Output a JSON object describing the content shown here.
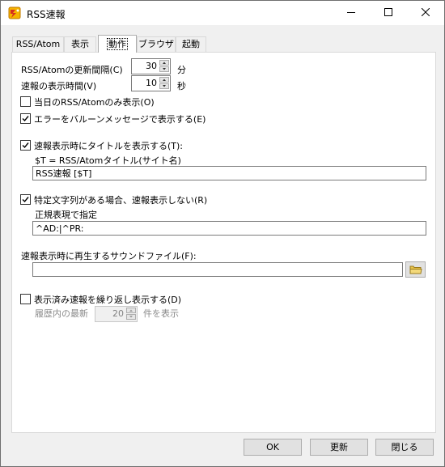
{
  "window": {
    "title": "RSS速報",
    "icon": "rss-app-icon",
    "controls": [
      "minimize-icon",
      "maximize-icon",
      "close-icon"
    ]
  },
  "tabs": [
    {
      "label": "RSS/Atom",
      "active": false
    },
    {
      "label": "表示",
      "active": false
    },
    {
      "label": "動作",
      "active": true
    },
    {
      "label": "ブラウザ",
      "active": false
    },
    {
      "label": "起動",
      "active": false
    }
  ],
  "settings": {
    "update_interval": {
      "label": "RSS/Atomの更新間隔(C)",
      "value": "30",
      "unit": "分"
    },
    "display_time": {
      "label": "速報の表示時間(V)",
      "value": "10",
      "unit": "秒"
    },
    "today_only": {
      "label": "当日のRSS/Atomのみ表示(O)",
      "checked": false
    },
    "error_balloon": {
      "label": "エラーをバルーンメッセージで表示する(E)",
      "checked": true
    },
    "show_title": {
      "label": "速報表示時にタイトルを表示する(T):",
      "checked": true,
      "hint": "$T = RSS/Atomタイトル(サイト名)",
      "value": "RSS速報 [$T]"
    },
    "exclude_pattern": {
      "label": "特定文字列がある場合、速報表示しない(R)",
      "checked": true,
      "hint": "正規表現で指定",
      "value": "^AD:|^PR:"
    },
    "sound_file": {
      "label": "速報表示時に再生するサウンドファイル(F):",
      "value": ""
    },
    "repeat_display": {
      "label": "表示済み速報を繰り返し表示する(D)",
      "checked": false,
      "prefix": "履歴内の最新",
      "value": "20",
      "suffix": "件を表示"
    }
  },
  "buttons": {
    "ok": "OK",
    "update": "更新",
    "close": "閉じる"
  },
  "colors": {
    "check": "#000000",
    "folder": "#e8c34a"
  }
}
